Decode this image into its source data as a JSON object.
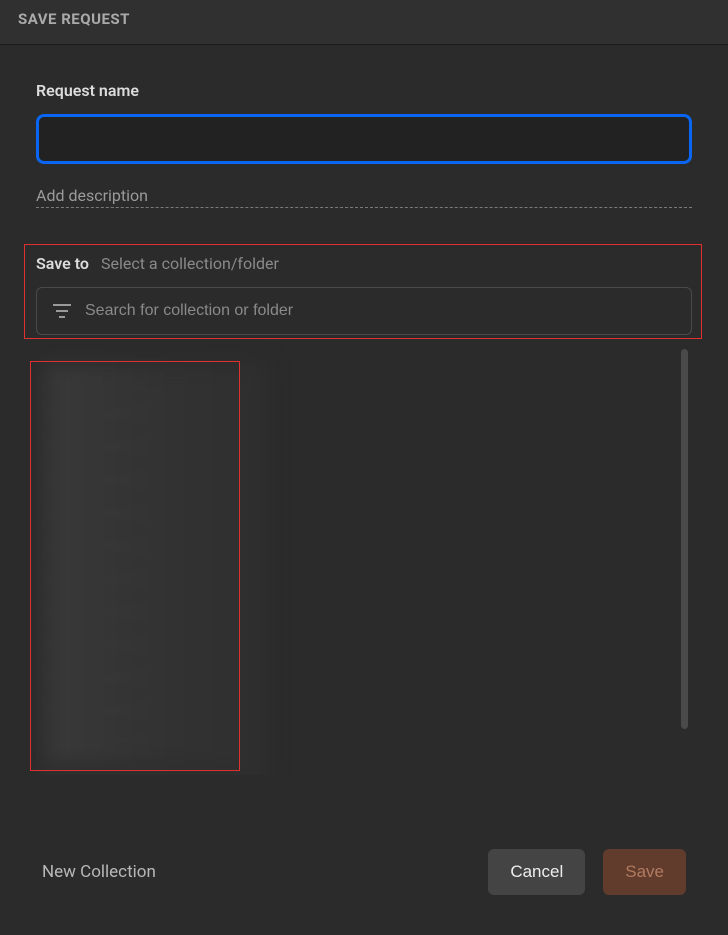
{
  "dialog": {
    "title": "SAVE REQUEST"
  },
  "requestName": {
    "label": "Request name",
    "value": ""
  },
  "addDescription": {
    "label": "Add description"
  },
  "saveTo": {
    "label": "Save to",
    "hint": "Select a collection/folder",
    "searchPlaceholder": "Search for collection or folder"
  },
  "footer": {
    "newCollection": "New Collection",
    "cancel": "Cancel",
    "save": "Save"
  }
}
